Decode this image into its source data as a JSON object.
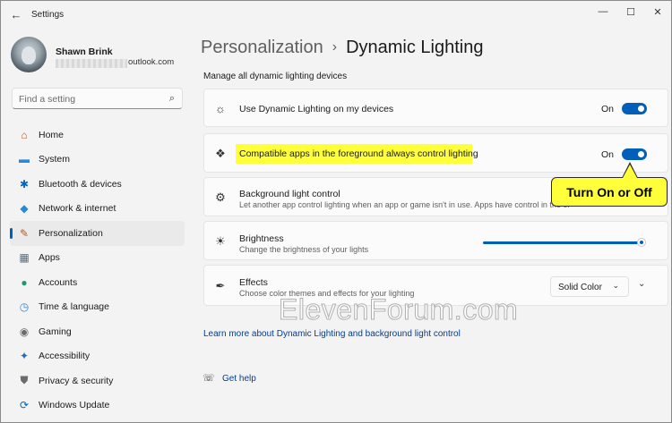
{
  "window": {
    "title": "Settings",
    "back_glyph": "←",
    "controls": {
      "minimize": "—",
      "maximize": "☐",
      "close": "✕"
    }
  },
  "profile": {
    "name": "Shawn Brink",
    "email_suffix": "outlook.com"
  },
  "search": {
    "placeholder": "Find a setting",
    "icon": "search-icon",
    "glyph": "⌕"
  },
  "sidebar": {
    "items": [
      {
        "label": "Home",
        "icon": "home-icon",
        "glyph": "⌂",
        "color": "#c2561a",
        "selected": false
      },
      {
        "label": "System",
        "icon": "monitor-icon",
        "glyph": "▬",
        "color": "#2b88d8",
        "selected": false
      },
      {
        "label": "Bluetooth & devices",
        "icon": "bluetooth-icon",
        "glyph": "✱",
        "color": "#0067c0",
        "selected": false
      },
      {
        "label": "Network & internet",
        "icon": "wifi-icon",
        "glyph": "◆",
        "color": "#2b88d8",
        "selected": false
      },
      {
        "label": "Personalization",
        "icon": "brush-icon",
        "glyph": "✎",
        "color": "#c2561a",
        "selected": true
      },
      {
        "label": "Apps",
        "icon": "apps-icon",
        "glyph": "▦",
        "color": "#5b6b7a",
        "selected": false
      },
      {
        "label": "Accounts",
        "icon": "person-icon",
        "glyph": "●",
        "color": "#1e9b6b",
        "selected": false
      },
      {
        "label": "Time & language",
        "icon": "globe-clock-icon",
        "glyph": "◷",
        "color": "#2b88d8",
        "selected": false
      },
      {
        "label": "Gaming",
        "icon": "controller-icon",
        "glyph": "◉",
        "color": "#6b6b6b",
        "selected": false
      },
      {
        "label": "Accessibility",
        "icon": "accessibility-icon",
        "glyph": "✦",
        "color": "#1f6fb5",
        "selected": false
      },
      {
        "label": "Privacy & security",
        "icon": "shield-icon",
        "glyph": "⛊",
        "color": "#6b6b6b",
        "selected": false
      },
      {
        "label": "Windows Update",
        "icon": "update-icon",
        "glyph": "⟳",
        "color": "#0067c0",
        "selected": false
      }
    ]
  },
  "breadcrumb": {
    "parent": "Personalization",
    "separator": "›",
    "current": "Dynamic Lighting"
  },
  "section_title": "Manage all dynamic lighting devices",
  "settings": {
    "use_dynamic": {
      "title": "Use Dynamic Lighting on my devices",
      "icon": "sun-rays-icon",
      "glyph": "☼",
      "state": "On"
    },
    "compatible_apps": {
      "title": "Compatible apps in the foreground always control lighting",
      "icon": "apps-lighting-icon",
      "glyph": "❖",
      "state": "On"
    },
    "background_control": {
      "title": "Background light control",
      "description": "Let another app control lighting when an app or game isn't in use. Apps have control in the or",
      "icon": "gear-icon",
      "glyph": "⚙"
    },
    "brightness": {
      "title": "Brightness",
      "description": "Change the brightness of your lights",
      "icon": "brightness-icon",
      "glyph": "☀",
      "value": 1.0
    },
    "effects": {
      "title": "Effects",
      "description": "Choose color themes and effects for your lighting",
      "icon": "pen-icon",
      "glyph": "✒",
      "selected": "Solid Color",
      "dropdown_glyph": "⌄",
      "expand_glyph": "⌄"
    }
  },
  "callout": "Turn On or Off",
  "watermark": "ElevenForum.com",
  "links": {
    "learn_more": "Learn more about Dynamic Lighting and background light control",
    "get_help": "Get help",
    "help_glyph": "☏"
  },
  "colors": {
    "accent": "#005fb8",
    "highlight": "#ffff3a",
    "link": "#003e92"
  }
}
